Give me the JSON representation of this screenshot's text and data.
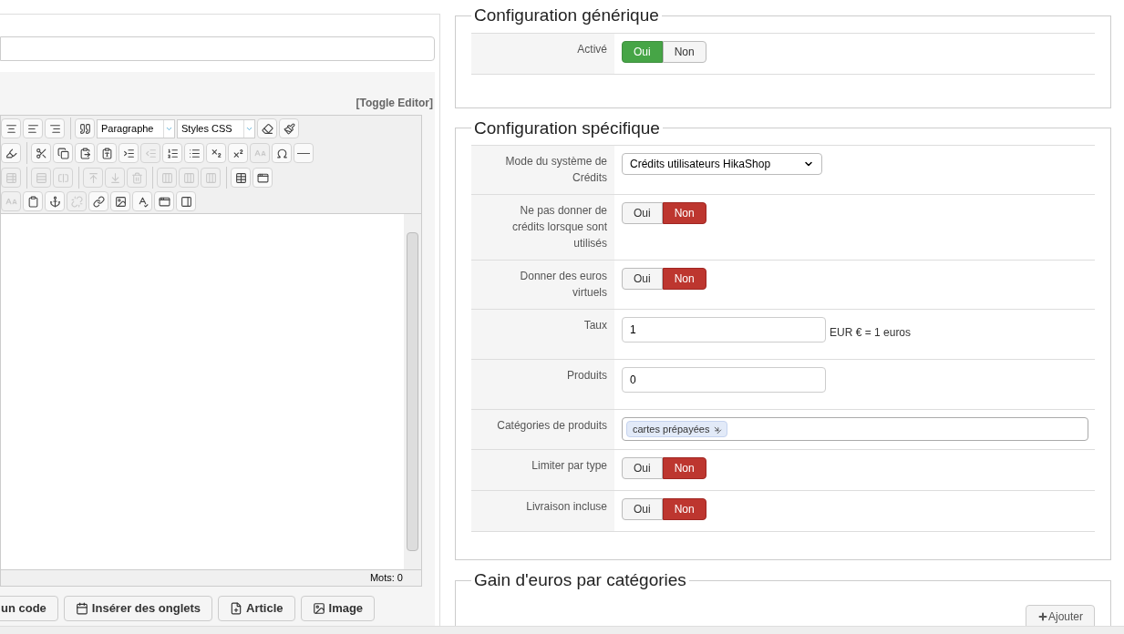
{
  "editor": {
    "toggle_label": "[Toggle Editor]",
    "toolbar": [
      [
        {
          "kind": "align-center",
          "disabled": false
        },
        {
          "kind": "align-left",
          "disabled": false
        },
        {
          "kind": "align-right",
          "disabled": false
        },
        {
          "kind": "sep"
        },
        {
          "kind": "quote",
          "disabled": false
        },
        {
          "kind": "select",
          "label": "Paragraphe"
        },
        {
          "kind": "select",
          "label": "Styles CSS"
        },
        {
          "kind": "eraser",
          "disabled": false
        },
        {
          "kind": "brush",
          "disabled": false
        }
      ],
      [
        {
          "kind": "highlighter",
          "disabled": false
        },
        {
          "kind": "sep"
        },
        {
          "kind": "scissors",
          "disabled": false
        },
        {
          "kind": "copy",
          "disabled": false
        },
        {
          "kind": "paste",
          "disabled": false
        },
        {
          "kind": "paste-text",
          "disabled": false
        },
        {
          "kind": "indent",
          "disabled": false
        },
        {
          "kind": "outdent",
          "disabled": true
        },
        {
          "kind": "ordered-list",
          "disabled": false
        },
        {
          "kind": "list",
          "disabled": false
        },
        {
          "kind": "subscript",
          "disabled": false
        },
        {
          "kind": "superscript",
          "disabled": false
        },
        {
          "kind": "font-size",
          "disabled": true
        },
        {
          "kind": "omega",
          "disabled": false
        },
        {
          "kind": "rule",
          "disabled": false
        }
      ],
      [
        {
          "kind": "delete-table",
          "disabled": true
        },
        {
          "kind": "sep"
        },
        {
          "kind": "row",
          "disabled": true
        },
        {
          "kind": "cell",
          "disabled": true
        },
        {
          "kind": "sep"
        },
        {
          "kind": "row-before",
          "disabled": true
        },
        {
          "kind": "row-after",
          "disabled": true
        },
        {
          "kind": "row-delete",
          "disabled": true
        },
        {
          "kind": "sep"
        },
        {
          "kind": "col-before",
          "disabled": true
        },
        {
          "kind": "col-after",
          "disabled": true
        },
        {
          "kind": "col-delete",
          "disabled": true
        },
        {
          "kind": "sep"
        },
        {
          "kind": "table",
          "disabled": false
        },
        {
          "kind": "frame",
          "disabled": false
        }
      ],
      [
        {
          "kind": "font-size",
          "disabled": true
        },
        {
          "kind": "clipboard",
          "disabled": false
        },
        {
          "kind": "anchor",
          "disabled": false
        },
        {
          "kind": "unlink",
          "disabled": true
        },
        {
          "kind": "link",
          "disabled": false
        },
        {
          "kind": "image",
          "disabled": false
        },
        {
          "kind": "spellcheck",
          "disabled": false
        },
        {
          "kind": "frame",
          "disabled": false
        },
        {
          "kind": "layout",
          "disabled": false
        }
      ]
    ],
    "word_count": "Mots: 0",
    "buttons": [
      {
        "kind": "code",
        "label": "un code"
      },
      {
        "kind": "tabs",
        "label": "Insérer des onglets"
      },
      {
        "kind": "article",
        "label": "Article"
      },
      {
        "kind": "image",
        "label": "Image"
      }
    ]
  },
  "sections": [
    {
      "title": "Configuration générique",
      "rows": [
        {
          "label": "Activé",
          "kind": "toggle",
          "options": [
            {
              "label": "Oui",
              "selected": true
            },
            {
              "label": "Non",
              "selected": false
            }
          ]
        }
      ]
    },
    {
      "title": "Configuration spécifique",
      "rows": [
        {
          "label": "Mode du système de Crédits",
          "kind": "select",
          "value": "Crédits utilisateurs HikaShop"
        },
        {
          "label": "Ne pas donner de crédits lorsque sont utilisés",
          "kind": "toggle",
          "options": [
            {
              "label": "Oui",
              "selected": false
            },
            {
              "label": "Non",
              "selected": true
            }
          ]
        },
        {
          "label": "Donner des euros virtuels",
          "kind": "toggle",
          "options": [
            {
              "label": "Oui",
              "selected": false
            },
            {
              "label": "Non",
              "selected": true
            }
          ]
        },
        {
          "label": "Taux",
          "kind": "input",
          "value": "1",
          "suffix": "EUR € = 1 euros"
        },
        {
          "label": "Produits",
          "kind": "input",
          "value": "0"
        },
        {
          "label": "Catégories de produits",
          "kind": "tags",
          "tags": [
            "cartes prépayées"
          ]
        },
        {
          "label": "Limiter par type",
          "kind": "toggle",
          "options": [
            {
              "label": "Oui",
              "selected": false
            },
            {
              "label": "Non",
              "selected": true
            }
          ]
        },
        {
          "label": "Livraison incluse",
          "kind": "toggle",
          "options": [
            {
              "label": "Oui",
              "selected": false
            },
            {
              "label": "Non",
              "selected": true
            }
          ]
        }
      ]
    },
    {
      "title": "Gain d'euros par catégories",
      "add_label": "Ajouter"
    }
  ]
}
